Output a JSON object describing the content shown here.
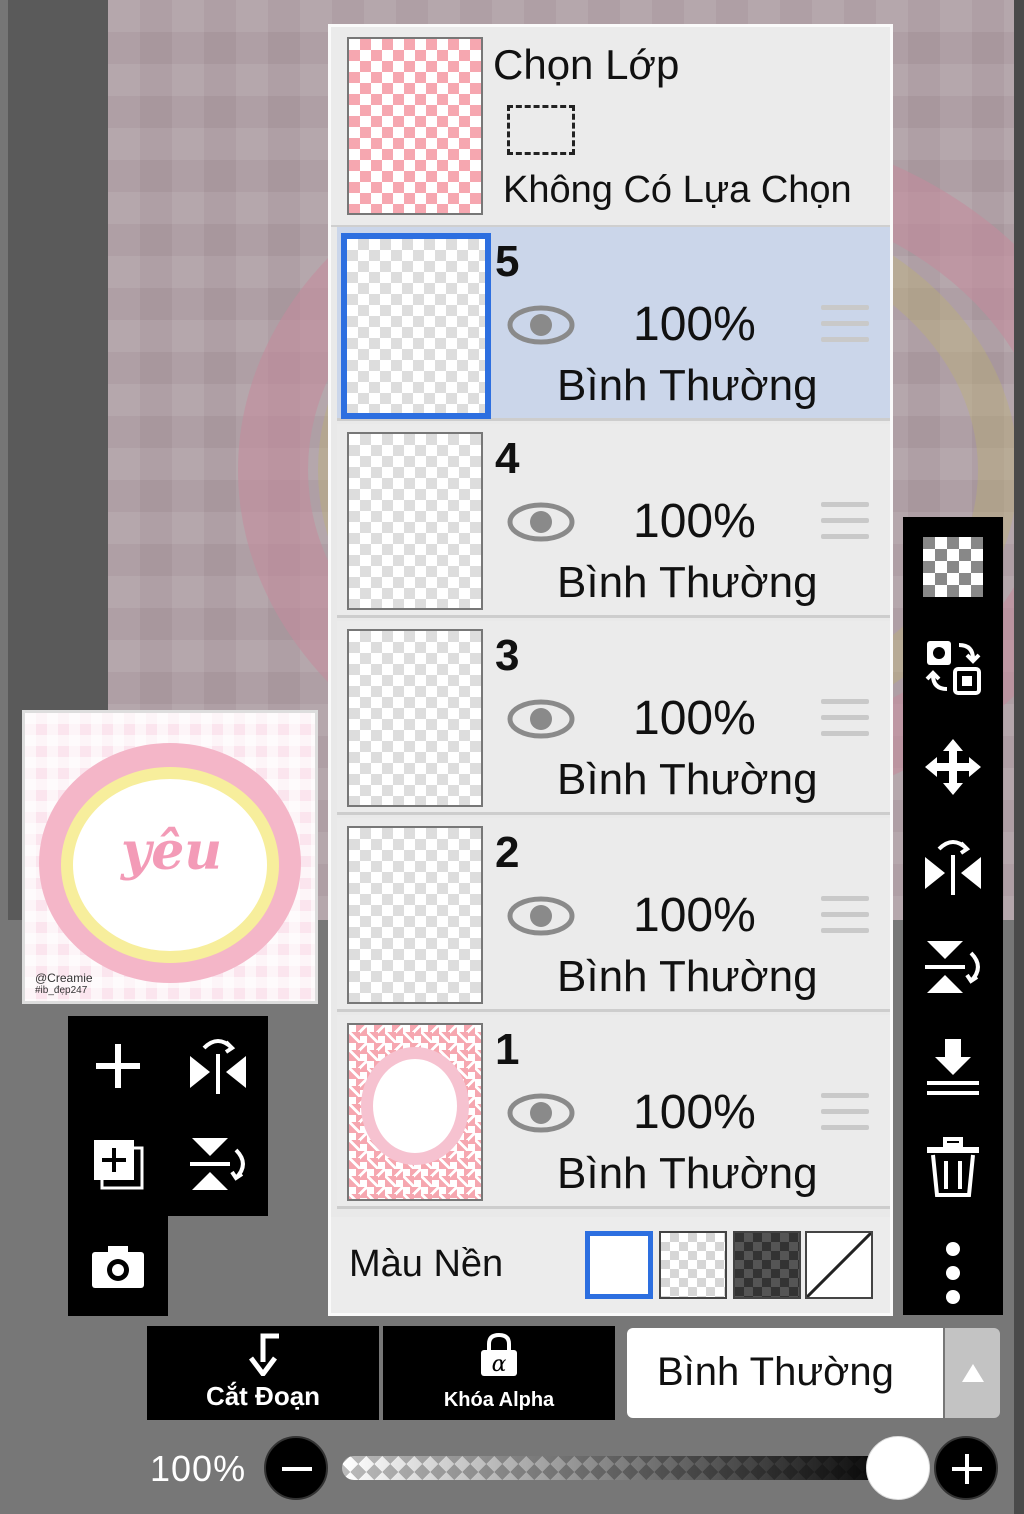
{
  "selection": {
    "title": "Chọn Lớp",
    "status": "Không Có Lựa Chọn"
  },
  "layers": [
    {
      "number": "5",
      "opacity": "100%",
      "mode": "Bình Thường",
      "active": true
    },
    {
      "number": "4",
      "opacity": "100%",
      "mode": "Bình Thường",
      "active": false
    },
    {
      "number": "3",
      "opacity": "100%",
      "mode": "Bình Thường",
      "active": false
    },
    {
      "number": "2",
      "opacity": "100%",
      "mode": "Bình Thường",
      "active": false
    },
    {
      "number": "1",
      "opacity": "100%",
      "mode": "Bình Thường",
      "active": false
    }
  ],
  "background": {
    "label": "Màu Nền",
    "options": [
      "white",
      "light-checker",
      "dark-checker",
      "none"
    ],
    "selected": "white"
  },
  "preview": {
    "word": "yêu",
    "credit_line1": "@Creamie",
    "credit_line2": "#ib_đẹp247"
  },
  "right_toolbar": [
    "transparency-icon",
    "swap-layer-icon",
    "move-icon",
    "flip-horizontal-icon",
    "flip-vertical-icon",
    "merge-down-icon",
    "trash-icon",
    "more-icon"
  ],
  "left_toolbar": [
    "add-layer-icon",
    "flip-horizontal-icon",
    "add-copy-icon",
    "flip-vertical-icon",
    "camera-icon"
  ],
  "bottom": {
    "clip_label": "Cắt Đoạn",
    "alpha_lock_label": "Khóa Alpha",
    "blend_mode": "Bình Thường"
  },
  "opacity_slider": {
    "label": "100%",
    "value": 1.0
  },
  "colors": {
    "accent": "#2d6fe0",
    "active_row": "#cbd6ea",
    "panel": "#e9e9e9"
  }
}
